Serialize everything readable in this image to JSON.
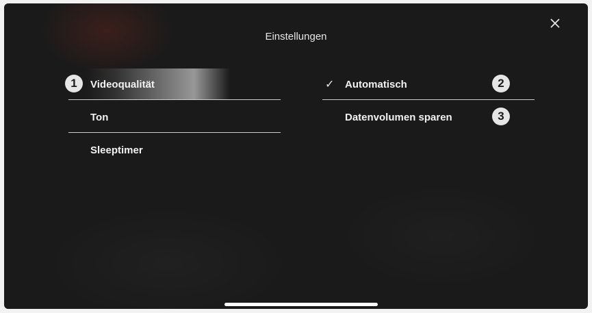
{
  "header": {
    "title": "Einstellungen"
  },
  "left_menu": {
    "items": [
      {
        "label": "Videoqualität",
        "badge": "1",
        "selected": true
      },
      {
        "label": "Ton"
      },
      {
        "label": "Sleeptimer"
      }
    ]
  },
  "right_menu": {
    "options": [
      {
        "label": "Automatisch",
        "badge": "2",
        "checked": true
      },
      {
        "label": "Datenvolumen sparen",
        "badge": "3",
        "checked": false
      }
    ]
  },
  "icons": {
    "close": "close-icon",
    "check": "checkmark-icon"
  }
}
